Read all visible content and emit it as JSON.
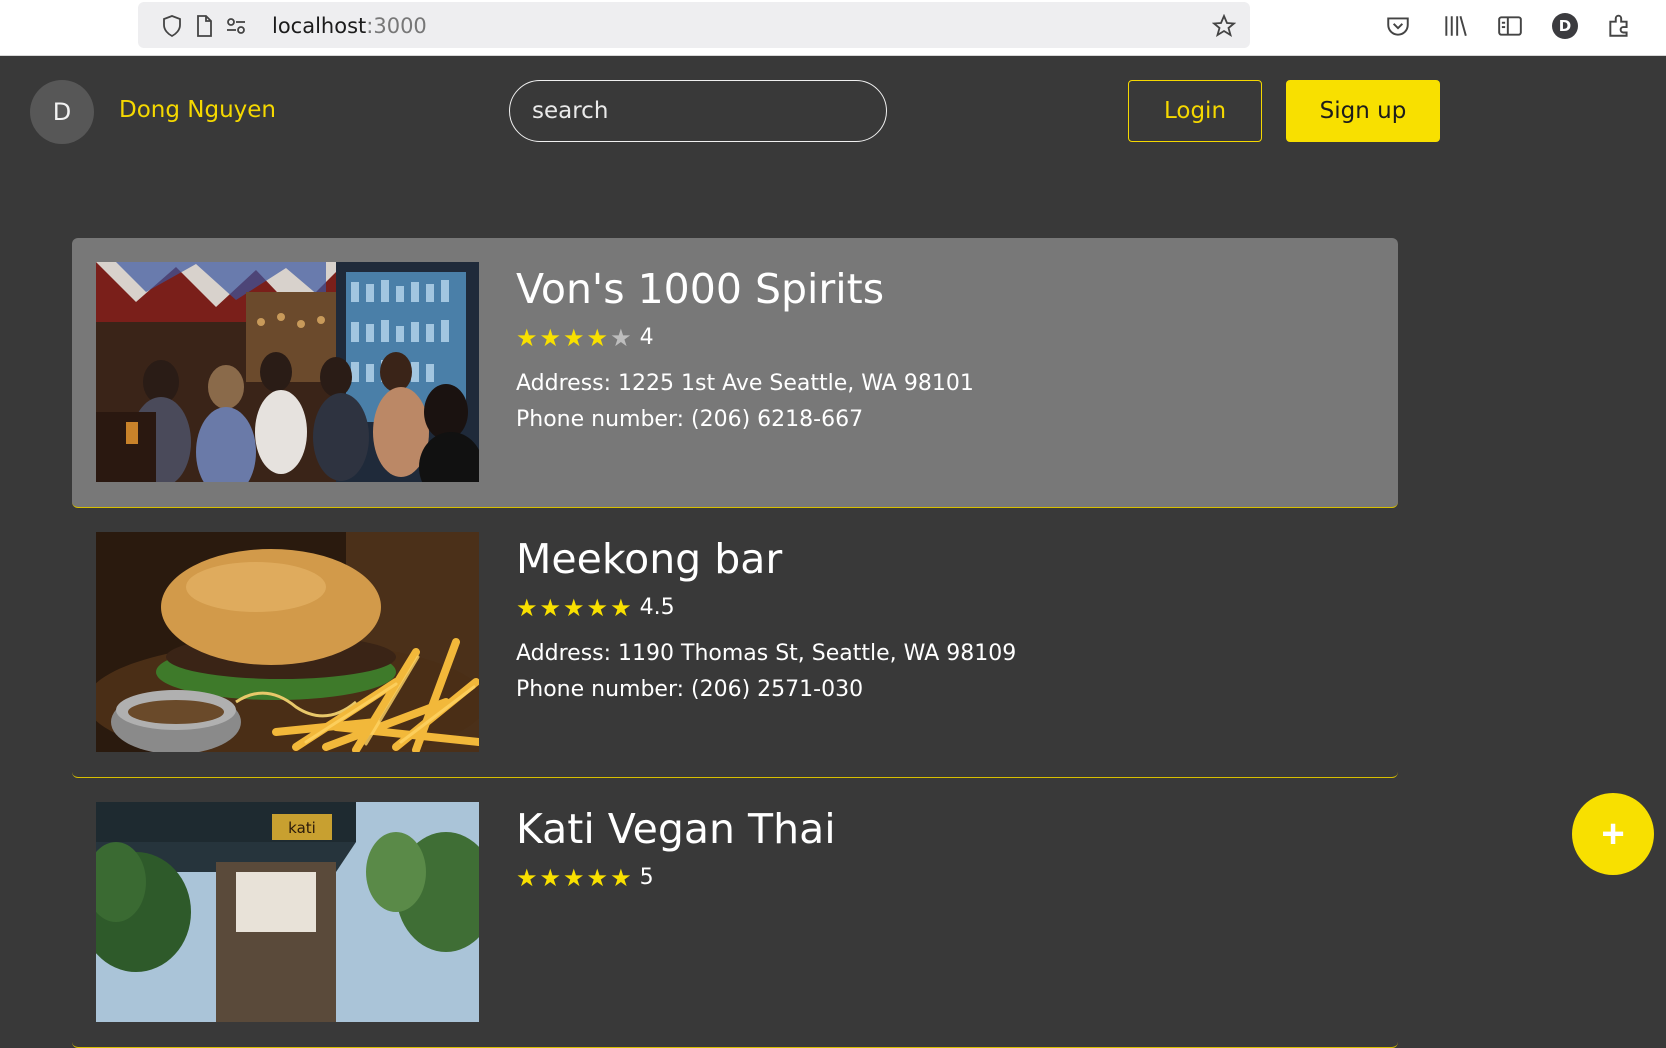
{
  "browser": {
    "url_host": "localhost",
    "url_port": ":3000",
    "profile_initial": "D"
  },
  "header": {
    "avatar_initial": "D",
    "username": "Dong Nguyen",
    "search_placeholder": "search",
    "login_label": "Login",
    "signup_label": "Sign up"
  },
  "listings": [
    {
      "name": "Von's 1000 Spirits",
      "rating": 4,
      "rating_text": "4",
      "address": "Address: 1225 1st Ave Seattle, WA 98101",
      "phone": "Phone number: (206) 6218-667",
      "active": true
    },
    {
      "name": "Meekong bar",
      "rating": 4.5,
      "rating_text": "4.5",
      "address": "Address: 1190 Thomas St, Seattle, WA 98109",
      "phone": "Phone number: (206) 2571-030",
      "active": false
    },
    {
      "name": "Kati Vegan Thai",
      "rating": 5,
      "rating_text": "5",
      "sign_text": "kati",
      "active": false
    }
  ],
  "fab_label": "+",
  "colors": {
    "accent": "#f8e000",
    "background": "#393939",
    "active_card": "#787878"
  }
}
